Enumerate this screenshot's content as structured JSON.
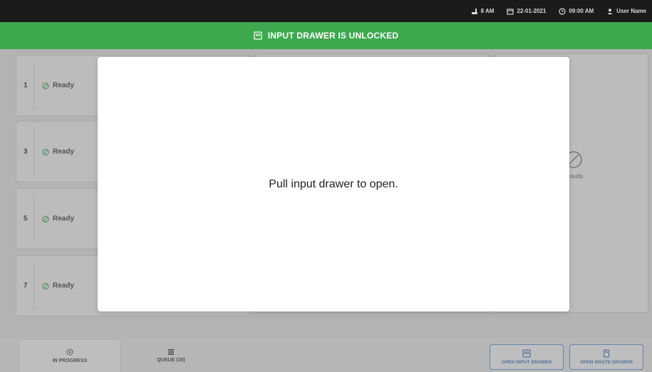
{
  "status_bar": {
    "temperature": "8 AM",
    "date": "22-01-2021",
    "time": "09:00 AM",
    "user": "User Name"
  },
  "banner": {
    "text": "INPUT DRAWER IS UNLOCKED",
    "icon": "drawer-icon",
    "color": "#3ea84f"
  },
  "slots": [
    {
      "number": "1",
      "status": "Ready"
    },
    {
      "number": "3",
      "status": "Ready"
    },
    {
      "number": "5",
      "status": "Ready"
    },
    {
      "number": "7",
      "status": "Ready"
    }
  ],
  "right_panel": {
    "partial_text": "t resutls.",
    "icon": "no-results-icon"
  },
  "modal": {
    "message": "Pull input drawer to open."
  },
  "bottom_nav": {
    "tabs": [
      {
        "label": "IN PROGRESS",
        "icon": "play-circle-icon"
      },
      {
        "label": "QUEUE (18)",
        "icon": "queue-icon"
      }
    ],
    "buttons": [
      {
        "label": "OPEN INPUT DRAWER",
        "icon": "drawer-icon"
      },
      {
        "label": "OPEN WASTE DRAWER",
        "icon": "waste-icon"
      }
    ],
    "accent": "#3b6eb0"
  }
}
